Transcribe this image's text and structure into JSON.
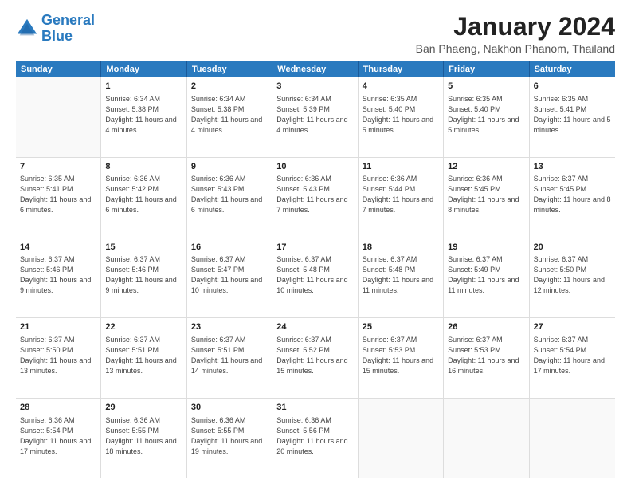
{
  "logo": {
    "line1": "General",
    "line2": "Blue"
  },
  "title": "January 2024",
  "subtitle": "Ban Phaeng, Nakhon Phanom, Thailand",
  "headers": [
    "Sunday",
    "Monday",
    "Tuesday",
    "Wednesday",
    "Thursday",
    "Friday",
    "Saturday"
  ],
  "rows": [
    [
      {
        "day": "",
        "sunrise": "",
        "sunset": "",
        "daylight": ""
      },
      {
        "day": "1",
        "sunrise": "Sunrise: 6:34 AM",
        "sunset": "Sunset: 5:38 PM",
        "daylight": "Daylight: 11 hours and 4 minutes."
      },
      {
        "day": "2",
        "sunrise": "Sunrise: 6:34 AM",
        "sunset": "Sunset: 5:38 PM",
        "daylight": "Daylight: 11 hours and 4 minutes."
      },
      {
        "day": "3",
        "sunrise": "Sunrise: 6:34 AM",
        "sunset": "Sunset: 5:39 PM",
        "daylight": "Daylight: 11 hours and 4 minutes."
      },
      {
        "day": "4",
        "sunrise": "Sunrise: 6:35 AM",
        "sunset": "Sunset: 5:40 PM",
        "daylight": "Daylight: 11 hours and 5 minutes."
      },
      {
        "day": "5",
        "sunrise": "Sunrise: 6:35 AM",
        "sunset": "Sunset: 5:40 PM",
        "daylight": "Daylight: 11 hours and 5 minutes."
      },
      {
        "day": "6",
        "sunrise": "Sunrise: 6:35 AM",
        "sunset": "Sunset: 5:41 PM",
        "daylight": "Daylight: 11 hours and 5 minutes."
      }
    ],
    [
      {
        "day": "7",
        "sunrise": "Sunrise: 6:35 AM",
        "sunset": "Sunset: 5:41 PM",
        "daylight": "Daylight: 11 hours and 6 minutes."
      },
      {
        "day": "8",
        "sunrise": "Sunrise: 6:36 AM",
        "sunset": "Sunset: 5:42 PM",
        "daylight": "Daylight: 11 hours and 6 minutes."
      },
      {
        "day": "9",
        "sunrise": "Sunrise: 6:36 AM",
        "sunset": "Sunset: 5:43 PM",
        "daylight": "Daylight: 11 hours and 6 minutes."
      },
      {
        "day": "10",
        "sunrise": "Sunrise: 6:36 AM",
        "sunset": "Sunset: 5:43 PM",
        "daylight": "Daylight: 11 hours and 7 minutes."
      },
      {
        "day": "11",
        "sunrise": "Sunrise: 6:36 AM",
        "sunset": "Sunset: 5:44 PM",
        "daylight": "Daylight: 11 hours and 7 minutes."
      },
      {
        "day": "12",
        "sunrise": "Sunrise: 6:36 AM",
        "sunset": "Sunset: 5:45 PM",
        "daylight": "Daylight: 11 hours and 8 minutes."
      },
      {
        "day": "13",
        "sunrise": "Sunrise: 6:37 AM",
        "sunset": "Sunset: 5:45 PM",
        "daylight": "Daylight: 11 hours and 8 minutes."
      }
    ],
    [
      {
        "day": "14",
        "sunrise": "Sunrise: 6:37 AM",
        "sunset": "Sunset: 5:46 PM",
        "daylight": "Daylight: 11 hours and 9 minutes."
      },
      {
        "day": "15",
        "sunrise": "Sunrise: 6:37 AM",
        "sunset": "Sunset: 5:46 PM",
        "daylight": "Daylight: 11 hours and 9 minutes."
      },
      {
        "day": "16",
        "sunrise": "Sunrise: 6:37 AM",
        "sunset": "Sunset: 5:47 PM",
        "daylight": "Daylight: 11 hours and 10 minutes."
      },
      {
        "day": "17",
        "sunrise": "Sunrise: 6:37 AM",
        "sunset": "Sunset: 5:48 PM",
        "daylight": "Daylight: 11 hours and 10 minutes."
      },
      {
        "day": "18",
        "sunrise": "Sunrise: 6:37 AM",
        "sunset": "Sunset: 5:48 PM",
        "daylight": "Daylight: 11 hours and 11 minutes."
      },
      {
        "day": "19",
        "sunrise": "Sunrise: 6:37 AM",
        "sunset": "Sunset: 5:49 PM",
        "daylight": "Daylight: 11 hours and 11 minutes."
      },
      {
        "day": "20",
        "sunrise": "Sunrise: 6:37 AM",
        "sunset": "Sunset: 5:50 PM",
        "daylight": "Daylight: 11 hours and 12 minutes."
      }
    ],
    [
      {
        "day": "21",
        "sunrise": "Sunrise: 6:37 AM",
        "sunset": "Sunset: 5:50 PM",
        "daylight": "Daylight: 11 hours and 13 minutes."
      },
      {
        "day": "22",
        "sunrise": "Sunrise: 6:37 AM",
        "sunset": "Sunset: 5:51 PM",
        "daylight": "Daylight: 11 hours and 13 minutes."
      },
      {
        "day": "23",
        "sunrise": "Sunrise: 6:37 AM",
        "sunset": "Sunset: 5:51 PM",
        "daylight": "Daylight: 11 hours and 14 minutes."
      },
      {
        "day": "24",
        "sunrise": "Sunrise: 6:37 AM",
        "sunset": "Sunset: 5:52 PM",
        "daylight": "Daylight: 11 hours and 15 minutes."
      },
      {
        "day": "25",
        "sunrise": "Sunrise: 6:37 AM",
        "sunset": "Sunset: 5:53 PM",
        "daylight": "Daylight: 11 hours and 15 minutes."
      },
      {
        "day": "26",
        "sunrise": "Sunrise: 6:37 AM",
        "sunset": "Sunset: 5:53 PM",
        "daylight": "Daylight: 11 hours and 16 minutes."
      },
      {
        "day": "27",
        "sunrise": "Sunrise: 6:37 AM",
        "sunset": "Sunset: 5:54 PM",
        "daylight": "Daylight: 11 hours and 17 minutes."
      }
    ],
    [
      {
        "day": "28",
        "sunrise": "Sunrise: 6:36 AM",
        "sunset": "Sunset: 5:54 PM",
        "daylight": "Daylight: 11 hours and 17 minutes."
      },
      {
        "day": "29",
        "sunrise": "Sunrise: 6:36 AM",
        "sunset": "Sunset: 5:55 PM",
        "daylight": "Daylight: 11 hours and 18 minutes."
      },
      {
        "day": "30",
        "sunrise": "Sunrise: 6:36 AM",
        "sunset": "Sunset: 5:55 PM",
        "daylight": "Daylight: 11 hours and 19 minutes."
      },
      {
        "day": "31",
        "sunrise": "Sunrise: 6:36 AM",
        "sunset": "Sunset: 5:56 PM",
        "daylight": "Daylight: 11 hours and 20 minutes."
      },
      {
        "day": "",
        "sunrise": "",
        "sunset": "",
        "daylight": ""
      },
      {
        "day": "",
        "sunrise": "",
        "sunset": "",
        "daylight": ""
      },
      {
        "day": "",
        "sunrise": "",
        "sunset": "",
        "daylight": ""
      }
    ]
  ]
}
